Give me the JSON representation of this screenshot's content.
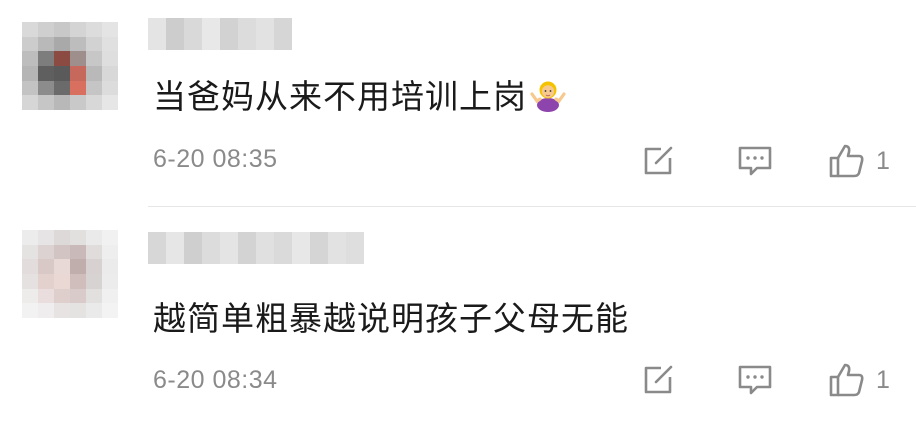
{
  "comments": [
    {
      "text": "当爸妈从来不用培训上岗",
      "emoji": "person-shrugging-emoji",
      "time": "6-20 08:35",
      "likes": "1",
      "icons": {
        "share": "share-icon",
        "reply": "reply-icon",
        "like": "thumbs-up-icon"
      }
    },
    {
      "text": "越简单粗暴越说明孩子父母无能",
      "time": "6-20 08:34",
      "likes": "1",
      "icons": {
        "share": "share-icon",
        "reply": "reply-icon",
        "like": "thumbs-up-icon"
      }
    }
  ],
  "colors": {
    "text": "#1a1a1a",
    "meta": "#8a8a8a",
    "divider": "#e6e6e6",
    "icon": "#8a8a8a"
  }
}
